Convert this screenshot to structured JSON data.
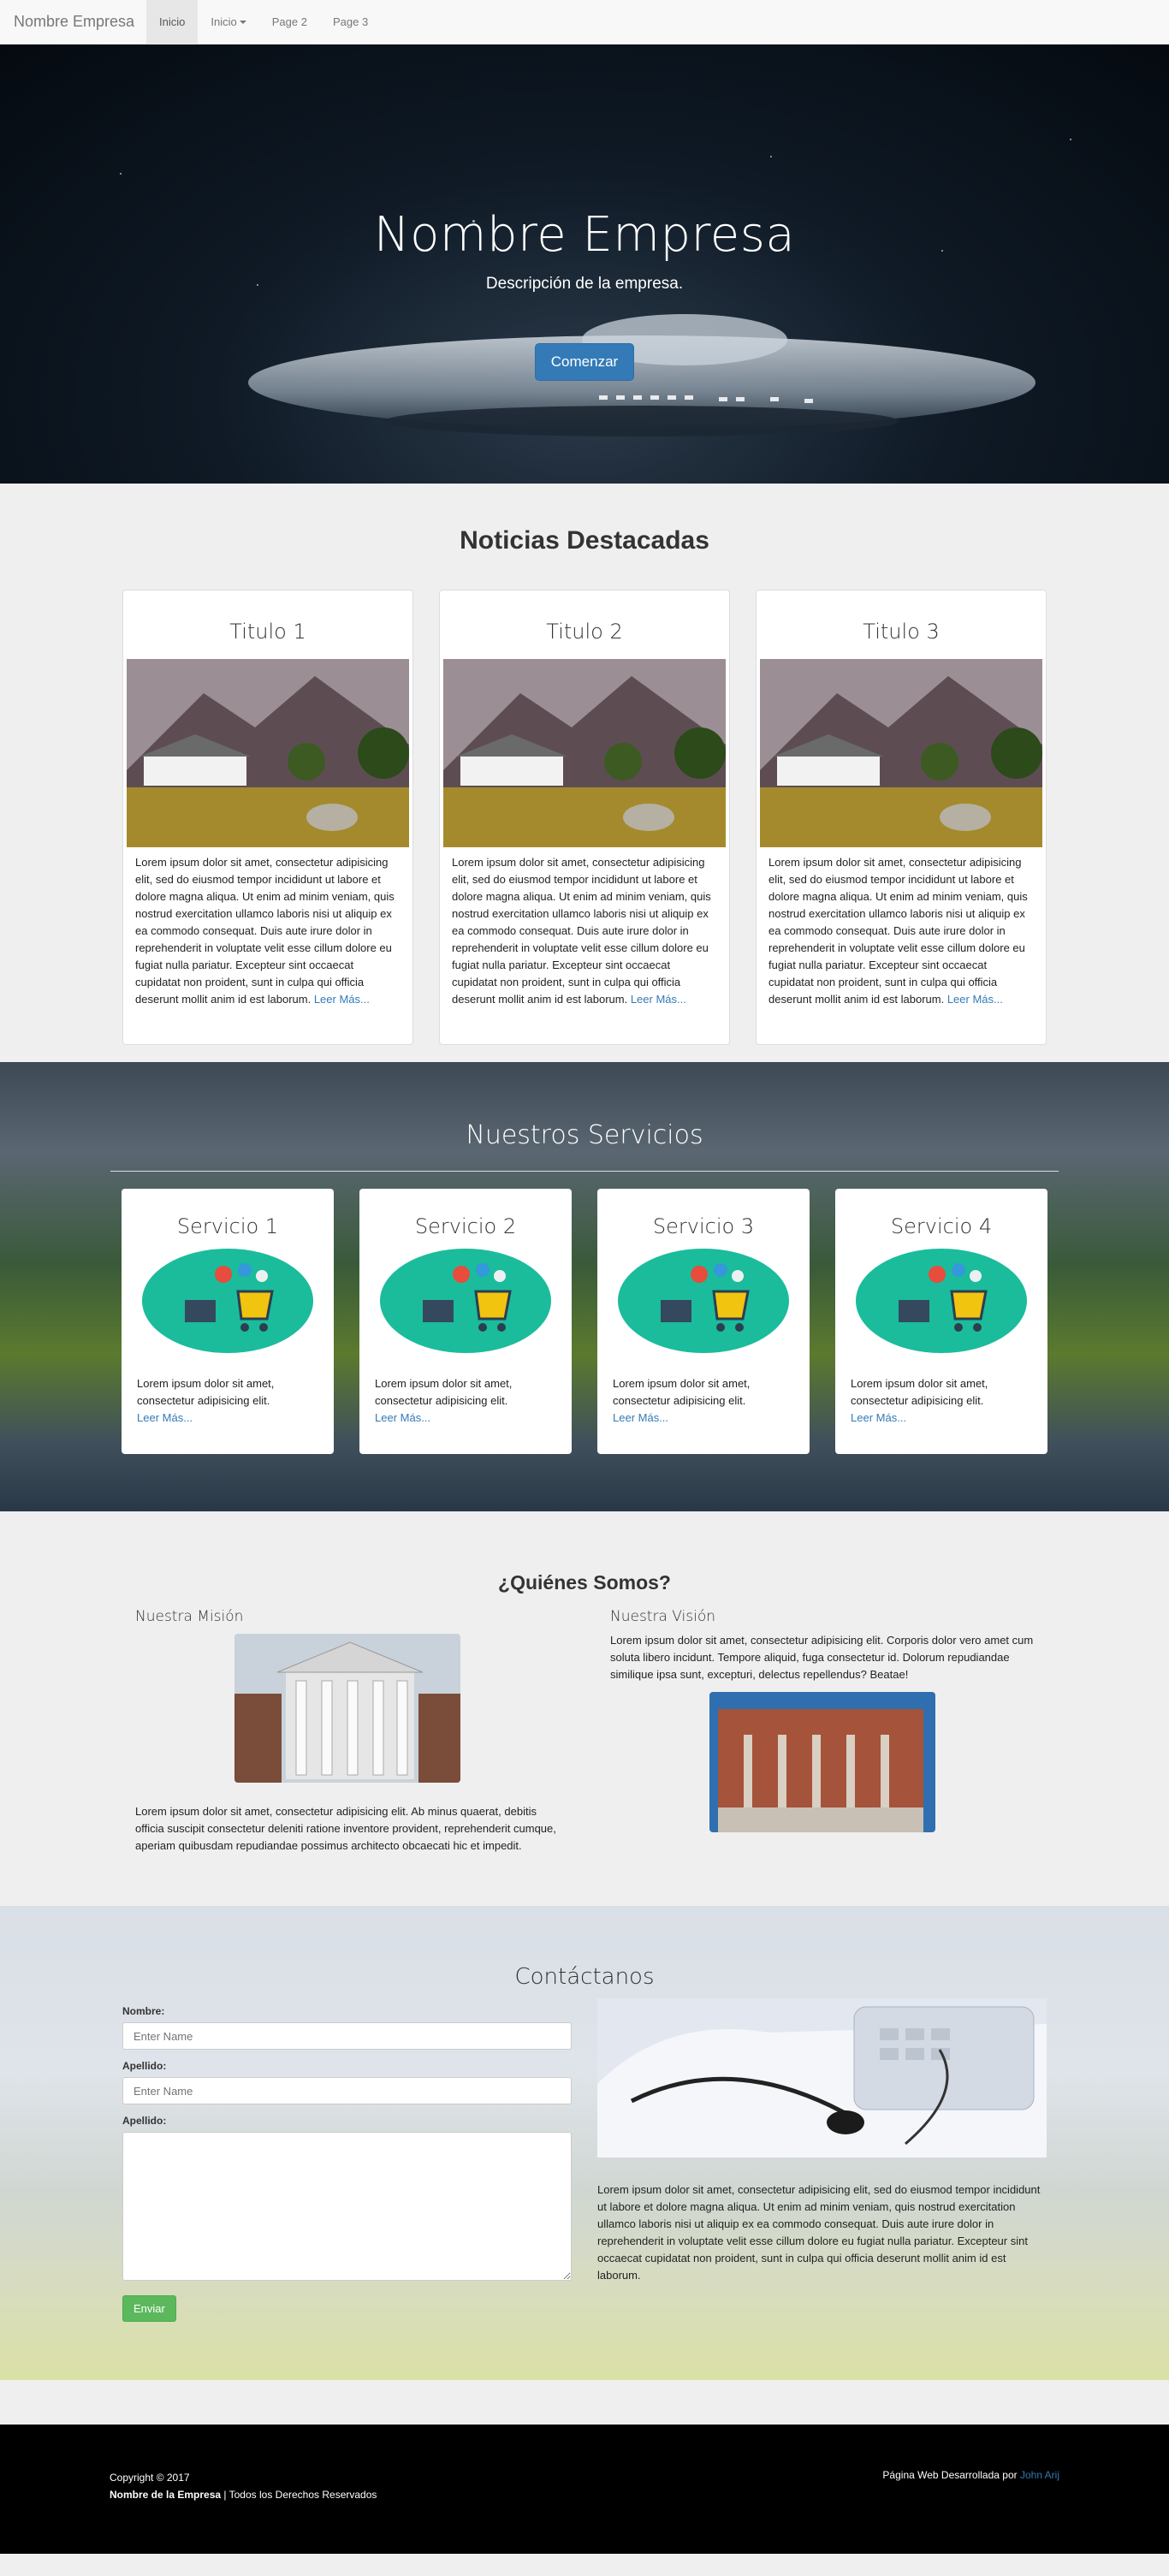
{
  "navbar": {
    "brand": "Nombre Empresa",
    "items": [
      {
        "label": "Inicio",
        "active": true
      },
      {
        "label": "Inicio",
        "dropdown": true
      },
      {
        "label": "Page 2"
      },
      {
        "label": "Page 3"
      }
    ]
  },
  "hero": {
    "title": "Nombre Empresa",
    "subtitle": "Descripción de la empresa.",
    "button": "Comenzar"
  },
  "news": {
    "title": "Noticias Destacadas",
    "cards": [
      {
        "title": "Titulo 1",
        "text": "Lorem ipsum dolor sit amet, consectetur adipisicing elit, sed do eiusmod tempor incididunt ut labore et dolore magna aliqua. Ut enim ad minim veniam, quis nostrud exercitation ullamco laboris nisi ut aliquip ex ea commodo consequat. Duis aute irure dolor in reprehenderit in voluptate velit esse cillum dolore eu fugiat nulla pariatur. Excepteur sint occaecat cupidatat non proident, sunt in culpa qui officia deserunt mollit anim id est laborum.",
        "link": "Leer Más..."
      },
      {
        "title": "Titulo 2",
        "text": "Lorem ipsum dolor sit amet, consectetur adipisicing elit, sed do eiusmod tempor incididunt ut labore et dolore magna aliqua. Ut enim ad minim veniam, quis nostrud exercitation ullamco laboris nisi ut aliquip ex ea commodo consequat. Duis aute irure dolor in reprehenderit in voluptate velit esse cillum dolore eu fugiat nulla pariatur. Excepteur sint occaecat cupidatat non proident, sunt in culpa qui officia deserunt mollit anim id est laborum.",
        "link": "Leer Más..."
      },
      {
        "title": "Titulo 3",
        "text": "Lorem ipsum dolor sit amet, consectetur adipisicing elit, sed do eiusmod tempor incididunt ut labore et dolore magna aliqua. Ut enim ad minim veniam, quis nostrud exercitation ullamco laboris nisi ut aliquip ex ea commodo consequat. Duis aute irure dolor in reprehenderit in voluptate velit esse cillum dolore eu fugiat nulla pariatur. Excepteur sint occaecat cupidatat non proident, sunt in culpa qui officia deserunt mollit anim id est laborum.",
        "link": "Leer Más..."
      }
    ]
  },
  "services": {
    "title": "Nuestros Servicios",
    "cards": [
      {
        "title": "Servicio 1",
        "text": "Lorem ipsum dolor sit amet, consectetur adipisicing elit.",
        "link": "Leer Más..."
      },
      {
        "title": "Servicio 2",
        "text": "Lorem ipsum dolor sit amet, consectetur adipisicing elit.",
        "link": "Leer Más..."
      },
      {
        "title": "Servicio 3",
        "text": "Lorem ipsum dolor sit amet, consectetur adipisicing elit.",
        "link": "Leer Más..."
      },
      {
        "title": "Servicio 4",
        "text": "Lorem ipsum dolor sit amet, consectetur adipisicing elit.",
        "link": "Leer Más..."
      }
    ]
  },
  "about": {
    "title": "¿Quiénes Somos?",
    "mission": {
      "heading": "Nuestra Misión",
      "text": "Lorem ipsum dolor sit amet, consectetur adipisicing elit. Ab minus quaerat, debitis officia suscipit consectetur deleniti ratione inventore provident, reprehenderit cumque, aperiam quibusdam repudiandae possimus architecto obcaecati hic et impedit."
    },
    "vision": {
      "heading": "Nuestra Visión",
      "text": "Lorem ipsum dolor sit amet, consectetur adipisicing elit. Corporis dolor vero amet cum soluta libero incidunt. Tempore aliquid, fuga consectetur id. Dolorum repudiandae similique ipsa sunt, excepturi, delectus repellendus? Beatae!"
    }
  },
  "contact": {
    "title": "Contáctanos",
    "fields": [
      {
        "label": "Nombre:",
        "placeholder": "Enter Name"
      },
      {
        "label": "Apellido:",
        "placeholder": "Enter Name"
      },
      {
        "label": "Apellido:"
      }
    ],
    "submit": "Enviar",
    "text": "Lorem ipsum dolor sit amet, consectetur adipisicing elit, sed do eiusmod tempor incididunt ut labore et dolore magna aliqua. Ut enim ad minim veniam, quis nostrud exercitation ullamco laboris nisi ut aliquip ex ea commodo consequat. Duis aute irure dolor in reprehenderit in voluptate velit esse cillum dolore eu fugiat nulla pariatur. Excepteur sint occaecat cupidatat non proident, sunt in culpa qui officia deserunt mollit anim id est laborum."
  },
  "footer": {
    "copyright": "Copyright © 2017",
    "company": "Nombre de la Empresa",
    "rights": " | Todos los Derechos Reservados",
    "credit": "Página Web Desarrollada por ",
    "author": "John Arij"
  },
  "colors": {
    "primary": "#337ab7",
    "success": "#5cb85c",
    "navbar_bg": "#f8f8f8",
    "footer_bg": "#000000",
    "service_icon_bg": "#1abc9c"
  }
}
